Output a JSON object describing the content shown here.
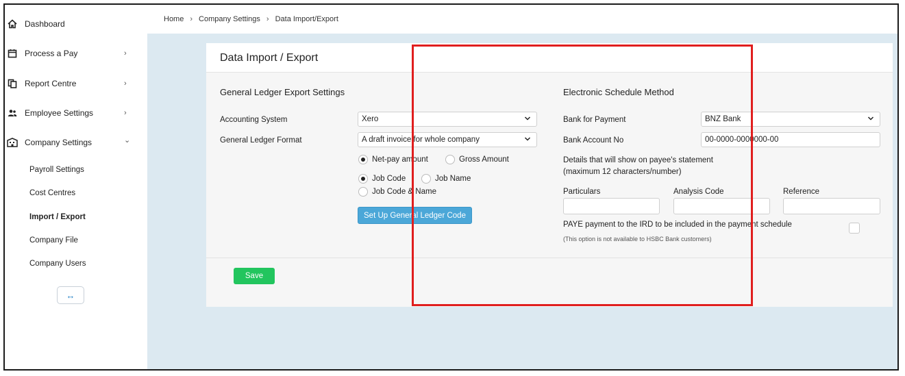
{
  "sidebar": {
    "items": [
      {
        "label": "Dashboard",
        "icon": "home-icon",
        "has_chevron": false,
        "chevron": ""
      },
      {
        "label": "Process a Pay",
        "icon": "calendar-icon",
        "has_chevron": true,
        "chevron": "›"
      },
      {
        "label": "Report Centre",
        "icon": "documents-icon",
        "has_chevron": true,
        "chevron": "›"
      },
      {
        "label": "Employee Settings",
        "icon": "people-icon",
        "has_chevron": true,
        "chevron": "›"
      },
      {
        "label": "Company Settings",
        "icon": "building-icon",
        "has_chevron": true,
        "chevron": "⌄"
      }
    ],
    "sub_items": [
      {
        "label": "Payroll Settings",
        "active": false
      },
      {
        "label": "Cost Centres",
        "active": false
      },
      {
        "label": "Import / Export",
        "active": true
      },
      {
        "label": "Company File",
        "active": false
      },
      {
        "label": "Company Users",
        "active": false
      }
    ],
    "collapse_glyph": "↔"
  },
  "breadcrumb": {
    "items": [
      "Home",
      "Company Settings",
      "Data Import/Export"
    ],
    "separator": "›"
  },
  "card": {
    "title": "Data Import / Export"
  },
  "gl_export": {
    "title": "General Ledger Export Settings",
    "accounting_system_label": "Accounting System",
    "accounting_system_value": "Xero",
    "gl_format_label": "General Ledger Format",
    "gl_format_value": "A draft invoice for whole company",
    "amount_options": [
      {
        "label": "Net-pay amount",
        "selected": true
      },
      {
        "label": "Gross Amount",
        "selected": false
      }
    ],
    "code_options": [
      {
        "label": "Job Code",
        "selected": true
      },
      {
        "label": "Job Name",
        "selected": false
      },
      {
        "label": "Job Code & Name",
        "selected": false
      }
    ],
    "setup_button_label": "Set Up General Ledger Code"
  },
  "schedule": {
    "title": "Electronic Schedule Method",
    "bank_label": "Bank for Payment",
    "bank_value": "BNZ Bank",
    "account_label": "Bank Account No",
    "account_value": "00-0000-0000000-00",
    "details_line1": "Details that will show on payee's statement",
    "details_line2": "(maximum 12 characters/number)",
    "particulars_label": "Particulars",
    "analysis_code_label": "Analysis Code",
    "reference_label": "Reference",
    "particulars_value": "",
    "analysis_code_value": "",
    "reference_value": "",
    "paye_label": "PAYE payment to the IRD to be included in the payment schedule",
    "paye_checked": false,
    "paye_note": "(This option is not available to HSBC Bank customers)"
  },
  "footer": {
    "save_label": "Save"
  },
  "colors": {
    "save_green": "#22c55e",
    "setup_blue": "#4ba7d8",
    "highlight_red": "#e01e1e",
    "main_bg": "#dce9f1"
  }
}
